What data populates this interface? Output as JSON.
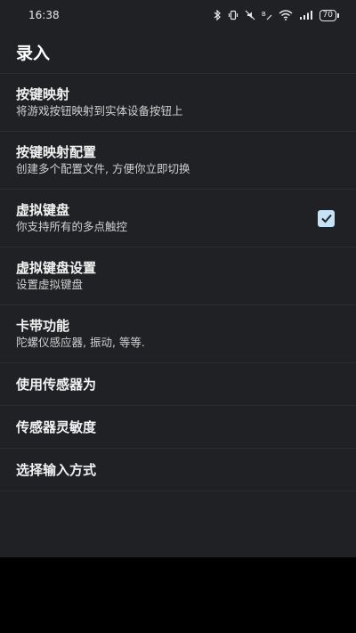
{
  "status": {
    "time": "16:38",
    "battery": "70"
  },
  "header": {
    "title": "录入"
  },
  "items": [
    {
      "title": "按键映射",
      "summary": "将游戏按钮映射到实体设备按钮上"
    },
    {
      "title": "按键映射配置",
      "summary": "创建多个配置文件, 方便你立即切换"
    },
    {
      "title": "虚拟键盘",
      "summary": "你支持所有的多点触控",
      "checked": true
    },
    {
      "title": "虚拟键盘设置",
      "summary": "设置虚拟键盘"
    },
    {
      "title": "卡带功能",
      "summary": "陀螺仪感应器, 振动, 等等."
    },
    {
      "title": "使用传感器为"
    },
    {
      "title": "传感器灵敏度"
    },
    {
      "title": "选择输入方式"
    }
  ],
  "colors": {
    "background": "#1f2124",
    "checkbox": "#c5e3f6",
    "nav_bar": "#000000"
  },
  "icons": [
    "bluetooth-icon",
    "vibrate-icon",
    "mute-icon",
    "data-speed-icon",
    "wifi-icon",
    "signal-icon",
    "battery-icon",
    "check-icon"
  ]
}
